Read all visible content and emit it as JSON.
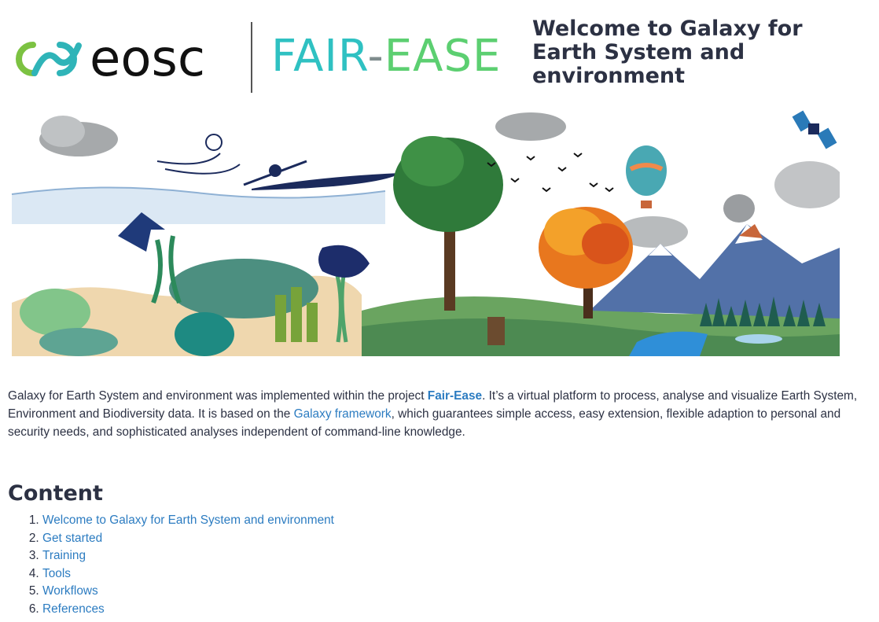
{
  "header": {
    "eosc_logo_text": "eosc",
    "fair_ease_logo": {
      "part1": "FAIR",
      "dash": "-",
      "part2": "EASE"
    },
    "title": "Welcome to Galaxy for Earth System and environment"
  },
  "hero": {
    "icon": "earth-system-illustration"
  },
  "intro": {
    "text_1": "Galaxy for Earth System and environment was implemented within the project ",
    "link_fair_ease": "Fair-Ease",
    "text_2": ". It’s a virtual platform to process, analyse and visualize Earth System, Environment and Biodiversity data. It is based on the ",
    "link_galaxy": "Galaxy framework",
    "text_3": ", which guarantees simple access, easy extension, flexible adaption to personal and security needs, and sophisticated analyses independent of command-line knowledge."
  },
  "content": {
    "heading": "Content",
    "items": [
      {
        "label": "Welcome to Galaxy for Earth System and environment"
      },
      {
        "label": "Get started"
      },
      {
        "label": "Training"
      },
      {
        "label": "Tools"
      },
      {
        "label": "Workflows"
      },
      {
        "label": "References"
      }
    ]
  },
  "colors": {
    "link": "#2c7cc1",
    "text": "#2c3143",
    "eosc_teal": "#2fb4b8",
    "eosc_green": "#7cc242",
    "fair": "#2fc1c2",
    "ease": "#5ccf71"
  }
}
